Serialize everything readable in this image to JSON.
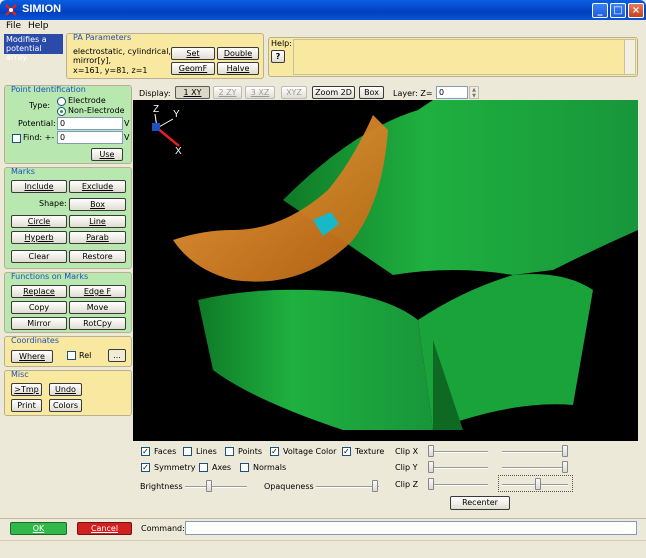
{
  "window": {
    "title": "SIMION"
  },
  "menu": {
    "file": "File",
    "help": "Help"
  },
  "help_tip": "Modifies a potential array.",
  "pa_params": {
    "title": "PA Parameters",
    "line1": "electrostatic, cylindrical,",
    "line2": "mirror[y],",
    "line3": "x=161, y=81, z=1",
    "set": "Set",
    "double": "Double",
    "geomf": "GeomF",
    "halve": "Halve"
  },
  "help_panel": {
    "title": "Help:",
    "q": "?"
  },
  "point_id": {
    "title": "Point Identification",
    "type_label": "Type:",
    "electrode": "Electrode",
    "non_electrode": "Non-Electrode",
    "potential_label": "Potential:",
    "potential_value": "0",
    "potential_unit": "V",
    "find_label": "Find: +-",
    "find_value": "0",
    "find_unit": "V",
    "use": "Use"
  },
  "marks": {
    "title": "Marks",
    "include": "Include",
    "exclude": "Exclude",
    "shape_label": "Shape:",
    "box": "Box",
    "circle": "Circle",
    "line": "Line",
    "hyperb": "Hyperb",
    "parab": "Parab",
    "clear": "Clear",
    "restore": "Restore"
  },
  "functions": {
    "title": "Functions on Marks",
    "replace": "Replace",
    "edgef": "Edge F",
    "copy": "Copy",
    "move": "Move",
    "mirror": "Mirror",
    "rotcpy": "RotCpy"
  },
  "coords": {
    "title": "Coordinates",
    "where": "Where",
    "rel": "Rel",
    "dots": "..."
  },
  "misc": {
    "title": "Misc",
    "tmp": ">Tmp",
    "undo": "Undo",
    "print": "Print",
    "colors": "Colors"
  },
  "display": {
    "label": "Display:",
    "xy": "1 XY",
    "zy": "2 ZY",
    "xz": "3 XZ",
    "xyz": "XYZ",
    "zoom2d": "Zoom 2D",
    "box": "Box",
    "layer_label": "Layer: Z=",
    "layer_value": "0"
  },
  "axes": {
    "z": "Z",
    "y": "Y",
    "x": "X"
  },
  "options": {
    "faces": "Faces",
    "lines": "Lines",
    "points": "Points",
    "voltage_color": "Voltage Color",
    "texture": "Texture",
    "symmetry": "Symmetry",
    "axes": "Axes",
    "normals": "Normals",
    "brightness": "Brightness",
    "opaqueness": "Opaqueness",
    "clipx": "Clip X",
    "clipy": "Clip Y",
    "clipz": "Clip Z",
    "recenter": "Recenter"
  },
  "bottom": {
    "ok": "OK",
    "cancel": "Cancel",
    "command_label": "Command:",
    "command_value": ""
  },
  "colors": {
    "green": "#22b050",
    "red": "#d42020",
    "electrode_green": "#1aa33a",
    "electrode_orange": "#e08c20"
  }
}
